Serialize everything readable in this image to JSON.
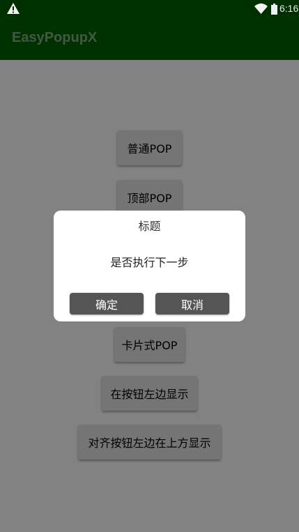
{
  "status_bar": {
    "time": "6:16",
    "icons": [
      "warning-icon",
      "wifi-icon",
      "battery-icon"
    ]
  },
  "app_bar": {
    "title": "EasyPopupX",
    "color": "#005f00"
  },
  "buttons": [
    {
      "label": "普通POP"
    },
    {
      "label": "顶部POP"
    },
    {
      "label": "卡片式POP"
    },
    {
      "label": "在按钮左边显示"
    },
    {
      "label": "对齐按钮左边在上方显示"
    }
  ],
  "dialog": {
    "title": "标题",
    "message": "是否执行下一步",
    "confirm_label": "确定",
    "cancel_label": "取消"
  }
}
